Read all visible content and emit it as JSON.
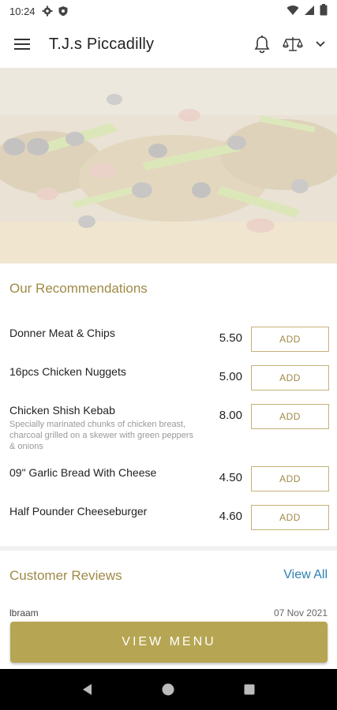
{
  "status_bar": {
    "time": "10:24"
  },
  "app_bar": {
    "title": "T.J.s Piccadilly"
  },
  "recommendations": {
    "title": "Our Recommendations",
    "add_label": "ADD",
    "items": [
      {
        "name": "Donner Meat & Chips",
        "price": "5.50",
        "description": ""
      },
      {
        "name": "16pcs Chicken Nuggets",
        "price": "5.00",
        "description": ""
      },
      {
        "name": "Chicken Shish Kebab",
        "price": "8.00",
        "description": "Specially marinated chunks of chicken breast, charcoal grilled on a skewer with green peppers & onions"
      },
      {
        "name": "09\" Garlic Bread With Cheese",
        "price": "4.50",
        "description": ""
      },
      {
        "name": "Half Pounder Cheeseburger",
        "price": "4.60",
        "description": ""
      }
    ]
  },
  "reviews": {
    "title": "Customer Reviews",
    "view_all": "View All",
    "first": {
      "name": "lbraam",
      "date": "07 Nov 2021"
    }
  },
  "cta": {
    "label": "VIEW MENU"
  },
  "colors": {
    "accent": "#b6a552",
    "accent_text": "#a08a47",
    "link": "#2b7fb0"
  },
  "icons": [
    "gear-icon",
    "shield-icon",
    "wifi-icon",
    "signal-icon",
    "battery-icon",
    "menu-icon",
    "bell-icon",
    "scale-icon",
    "chevron-down-icon",
    "back-icon",
    "home-icon",
    "recents-icon"
  ]
}
